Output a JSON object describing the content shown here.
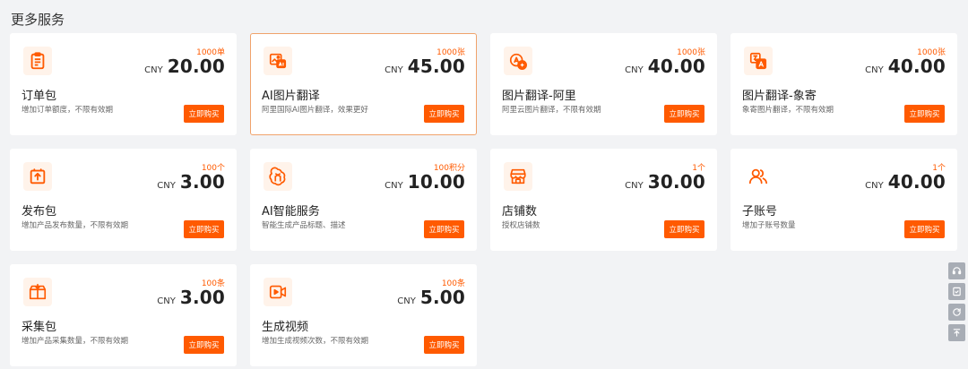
{
  "section": {
    "title": "更多服务"
  },
  "cards": [
    {
      "icon": "clipboard-icon",
      "quota": "1000单",
      "currency": "CNY",
      "price": "20.00",
      "name": "订单包",
      "desc": "增加订单额度，不限有效期",
      "button": "立即购买"
    },
    {
      "icon": "ai-image-translate-icon",
      "quota": "1000张",
      "currency": "CNY",
      "price": "45.00",
      "name": "AI图片翻译",
      "desc": "阿里国际AI图片翻译，效果更好",
      "button": "立即购买"
    },
    {
      "icon": "translate-icon",
      "quota": "1000张",
      "currency": "CNY",
      "price": "40.00",
      "name": "图片翻译-阿里",
      "desc": "阿里云图片翻译，不限有效期",
      "button": "立即购买"
    },
    {
      "icon": "translate-doc-icon",
      "quota": "1000张",
      "currency": "CNY",
      "price": "40.00",
      "name": "图片翻译-象寄",
      "desc": "象寄图片翻译，不限有效期",
      "button": "立即购买"
    },
    {
      "icon": "upload-box-icon",
      "quota": "100个",
      "currency": "CNY",
      "price": "3.00",
      "name": "发布包",
      "desc": "增加产品发布数量，不限有效期",
      "button": "立即购买"
    },
    {
      "icon": "ai-knot-icon",
      "quota": "100积分",
      "currency": "CNY",
      "price": "10.00",
      "name": "AI智能服务",
      "desc": "智能生成产品标题、描述",
      "button": "立即购买"
    },
    {
      "icon": "store-icon",
      "quota": "1个",
      "currency": "CNY",
      "price": "30.00",
      "name": "店铺数",
      "desc": "授权店铺数",
      "button": "立即购买"
    },
    {
      "icon": "users-icon",
      "quota": "1个",
      "currency": "CNY",
      "price": "40.00",
      "name": "子账号",
      "desc": "增加子账号数量",
      "button": "立即购买"
    },
    {
      "icon": "collect-box-icon",
      "quota": "100条",
      "currency": "CNY",
      "price": "3.00",
      "name": "采集包",
      "desc": "增加产品采集数量，不限有效期",
      "button": "立即购买"
    },
    {
      "icon": "video-icon",
      "quota": "100条",
      "currency": "CNY",
      "price": "5.00",
      "name": "生成视频",
      "desc": "增加生成视频次数，不限有效期",
      "button": "立即购买"
    }
  ],
  "side_tools": [
    "headset-icon",
    "clipboard-check-icon",
    "refresh-icon",
    "back-to-top-icon"
  ],
  "colors": {
    "accent": "#ff5a00",
    "active_border": "#f0a36b",
    "icon_bg": "#fff3ea"
  }
}
